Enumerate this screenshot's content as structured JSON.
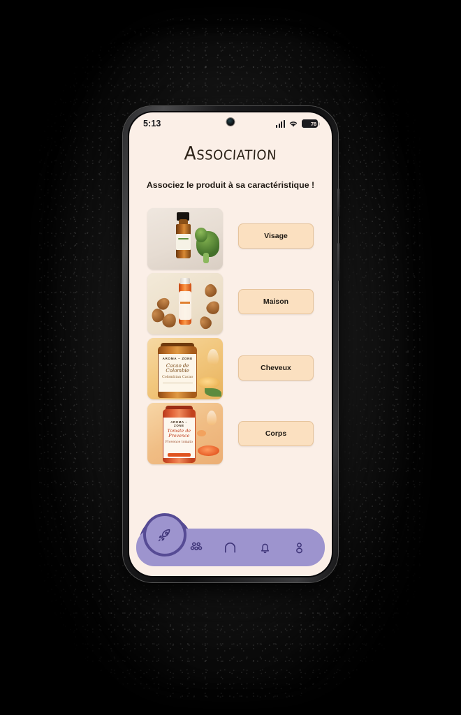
{
  "status_bar": {
    "time": "5:13",
    "battery_level": "78",
    "signal_icon": "signal-bars-icon",
    "wifi_icon": "wifi-icon",
    "battery_icon": "battery-icon"
  },
  "header": {
    "title": "Association",
    "subtitle": "Associez le produit à sa caractéristique !"
  },
  "products": [
    {
      "id": "product-1",
      "alt": "Flacon d'huile essentielle ambré avec brocoli",
      "brand": "",
      "name_fr": "",
      "name_en": ""
    },
    {
      "id": "product-2",
      "alt": "Flacon d'huile orange avec amandes",
      "brand": "",
      "name_fr": "",
      "name_en": ""
    },
    {
      "id": "product-3",
      "alt": "Pot Aroma-Zone Cacao de Colombie",
      "brand": "AROMA – ZONE",
      "name_fr": "Cacao de Colombie",
      "name_en": "Colombian Cacao"
    },
    {
      "id": "product-4",
      "alt": "Pot Aroma-Zone Tomate de Provence",
      "brand": "AROMA – ZONE",
      "name_fr": "Tomate de Provence",
      "name_en": "Provence tomato"
    }
  ],
  "answers": [
    {
      "id": "answer-visage",
      "label": "Visage"
    },
    {
      "id": "answer-maison",
      "label": "Maison"
    },
    {
      "id": "answer-cheveux",
      "label": "Cheveux"
    },
    {
      "id": "answer-corps",
      "label": "Corps"
    }
  ],
  "bottom_nav": {
    "items": [
      {
        "id": "nav-rocket",
        "icon": "rocket-icon",
        "active": true
      },
      {
        "id": "nav-group",
        "icon": "group-icon",
        "active": false
      },
      {
        "id": "nav-home",
        "icon": "home-icon",
        "active": false
      },
      {
        "id": "nav-bell",
        "icon": "bell-icon",
        "active": false
      },
      {
        "id": "nav-profile",
        "icon": "profile-icon",
        "active": false
      }
    ]
  },
  "colors": {
    "screen_bg": "#FBEFE7",
    "answer_button": "#FBE0C0",
    "answer_button_border": "#E6C49C",
    "nav_bar": "#9D94CE",
    "nav_active_blob": "#564B94",
    "text_dark": "#201A14",
    "page_bg": "#000000"
  }
}
